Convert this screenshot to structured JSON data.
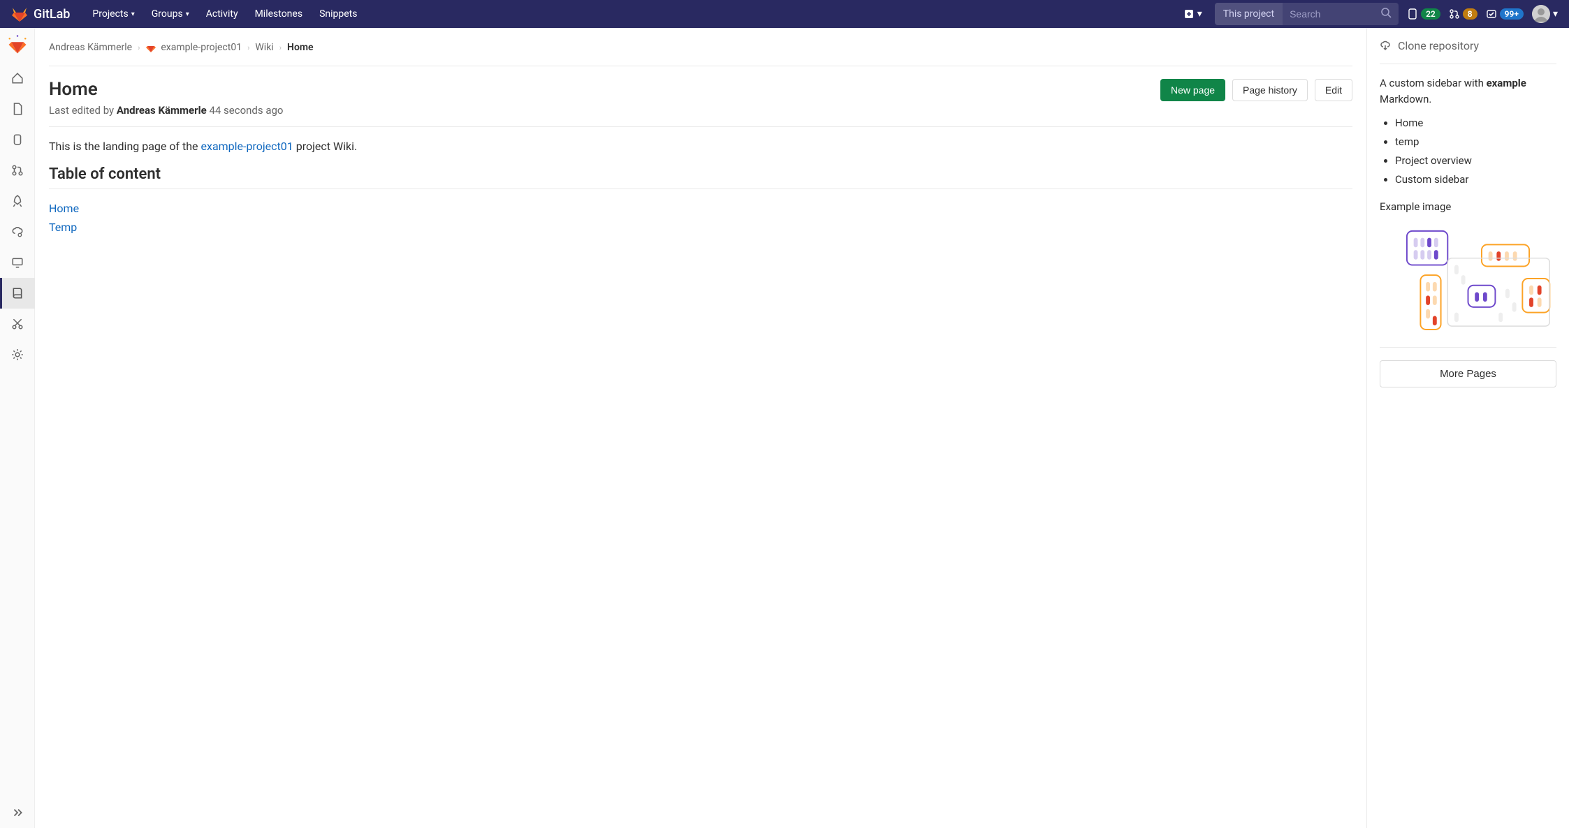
{
  "navbar": {
    "brand": "GitLab",
    "links": {
      "projects": "Projects",
      "groups": "Groups",
      "activity": "Activity",
      "milestones": "Milestones",
      "snippets": "Snippets"
    },
    "search": {
      "scope": "This project",
      "placeholder": "Search"
    },
    "badges": {
      "issues": "22",
      "mrs": "8",
      "todos": "99+"
    }
  },
  "breadcrumbs": {
    "user": "Andreas Kämmerle",
    "project": "example-project01",
    "section": "Wiki",
    "page": "Home"
  },
  "page": {
    "title": "Home",
    "edited_prefix": "Last edited by ",
    "edited_by": "Andreas Kämmerle",
    "edited_time": "44 seconds ago",
    "buttons": {
      "new_page": "New page",
      "history": "Page history",
      "edit": "Edit"
    }
  },
  "wiki": {
    "intro_before": "This is the landing page of the ",
    "intro_link": "example-project01",
    "intro_after": " project Wiki.",
    "toc_heading": "Table of content",
    "toc": {
      "home": "Home",
      "temp": "Temp"
    }
  },
  "sidebar": {
    "clone": "Clone repository",
    "desc_before": "A custom sidebar with ",
    "desc_bold": "example",
    "desc_after": " Markdown.",
    "items": {
      "0": "Home",
      "1": "temp",
      "2": "Project overview",
      "3": "Custom sidebar"
    },
    "img_heading": "Example image",
    "more": "More Pages"
  }
}
